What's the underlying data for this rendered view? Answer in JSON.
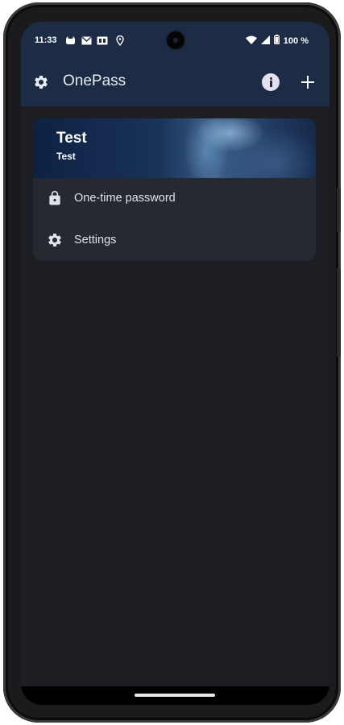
{
  "status_bar": {
    "time": "11:33",
    "battery": "100 %",
    "left_icons": [
      "cat-icon",
      "gmail-icon",
      "cast-icon",
      "location-icon"
    ],
    "right_icons": [
      "wifi-icon",
      "signal-icon",
      "battery-icon"
    ]
  },
  "toolbar": {
    "title": "OnePass",
    "left_icon": "gear-icon",
    "right_icons": [
      "info-icon",
      "plus-icon"
    ]
  },
  "card": {
    "title": "Test",
    "subtitle": "Test",
    "items": [
      {
        "label": "One-time password",
        "icon": "lock-icon"
      },
      {
        "label": "Settings",
        "icon": "gear-icon"
      }
    ]
  },
  "colors": {
    "app_bar": "#1e2b45",
    "background": "#1d1e23",
    "card": "#272930",
    "text_primary": "#ffffff",
    "text_secondary": "#dfe2ea"
  }
}
